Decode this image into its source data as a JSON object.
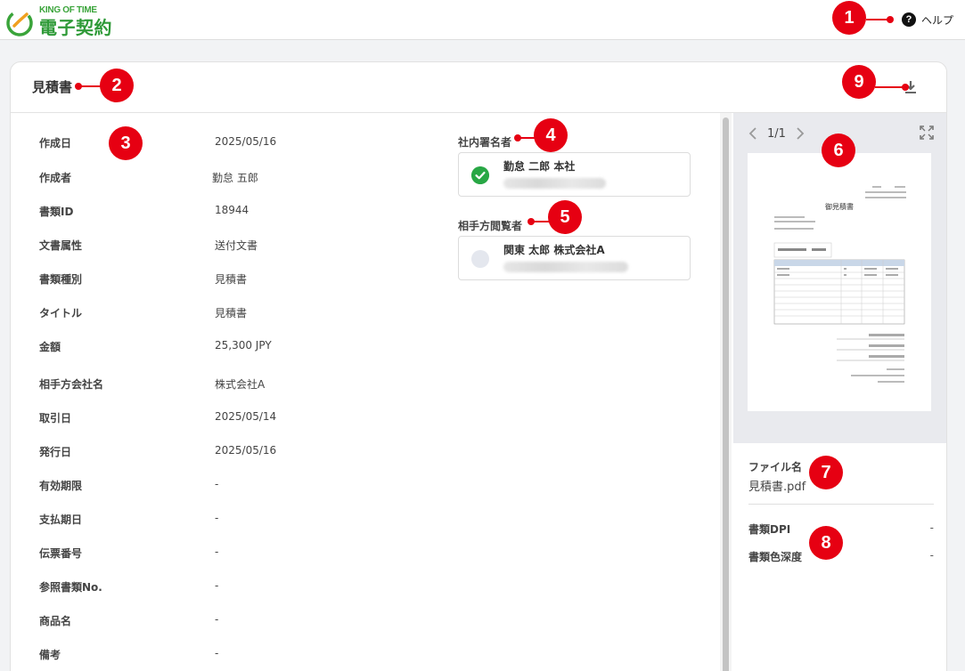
{
  "app": {
    "logo_top": "KING OF TIME",
    "logo_main": "電子契約",
    "help_label": "ヘルプ"
  },
  "document": {
    "title": "見積書",
    "properties": [
      {
        "label": "作成日",
        "value": "2025/05/16"
      },
      {
        "label": "作成者",
        "value": "勤怠 五郎"
      },
      {
        "label": "書類ID",
        "value": "18944"
      },
      {
        "label": "文書属性",
        "value": "送付文書"
      },
      {
        "label": "書類種別",
        "value": "見積書"
      },
      {
        "label": "タイトル",
        "value": "見積書"
      },
      {
        "label": "金額",
        "value": "25,300 JPY"
      },
      {
        "label": "相手方会社名",
        "value": "株式会社A"
      },
      {
        "label": "取引日",
        "value": "2025/05/14"
      },
      {
        "label": "発行日",
        "value": "2025/05/16"
      },
      {
        "label": "有効期限",
        "value": "-"
      },
      {
        "label": "支払期日",
        "value": "-"
      },
      {
        "label": "伝票番号",
        "value": "-"
      },
      {
        "label": "参照書類No.",
        "value": "-"
      },
      {
        "label": "商品名",
        "value": "-"
      },
      {
        "label": "備考",
        "value": "-"
      }
    ]
  },
  "signers": {
    "internal_label": "社内署名者",
    "internal_name": "勤怠 二郎 本社",
    "internal_status": "signed",
    "external_label": "相手方閲覧者",
    "external_name": "関東 太郎 株式会社A",
    "external_status": "pending"
  },
  "preview": {
    "page_indicator": "1/1",
    "thumb_title": "御見積書"
  },
  "file": {
    "name_label": "ファイル名",
    "name_value": "見積書.pdf",
    "dpi_label": "書類DPI",
    "dpi_value": "-",
    "depth_label": "書類色深度",
    "depth_value": "-"
  },
  "annotations": [
    "1",
    "2",
    "3",
    "4",
    "5",
    "6",
    "7",
    "8",
    "9"
  ],
  "colors": {
    "brand_green": "#2f9a38",
    "callout_red": "#e60012",
    "signed_green": "#28a745"
  }
}
